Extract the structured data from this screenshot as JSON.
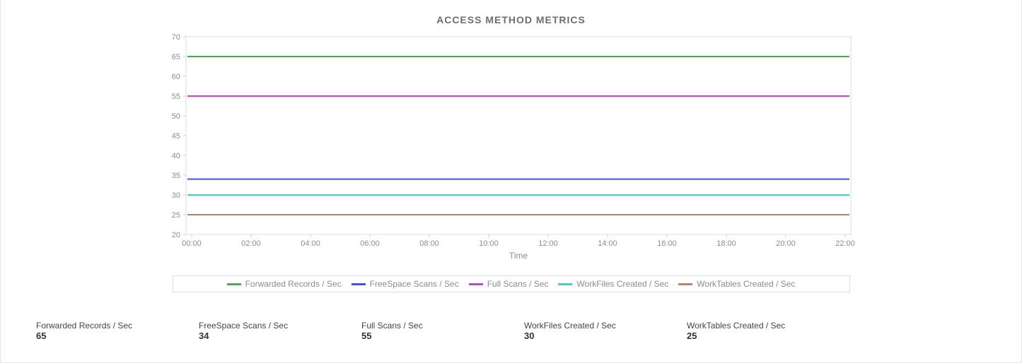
{
  "chart_data": {
    "type": "line",
    "title": "ACCESS METHOD METRICS",
    "xlabel": "Time",
    "ylabel": "",
    "ylim": [
      20,
      70
    ],
    "yticks": [
      20,
      25,
      30,
      35,
      40,
      45,
      50,
      55,
      60,
      65,
      70
    ],
    "categories": [
      "00:00",
      "02:00",
      "04:00",
      "06:00",
      "08:00",
      "10:00",
      "12:00",
      "14:00",
      "16:00",
      "18:00",
      "20:00",
      "22:00"
    ],
    "series": [
      {
        "name": "Forwarded Records / Sec",
        "color": "#3cb544",
        "values": [
          65,
          65,
          65,
          65,
          65,
          65,
          65,
          65,
          65,
          65,
          65,
          65
        ]
      },
      {
        "name": "FreeSpace Scans / Sec",
        "color": "#4b4bff",
        "values": [
          34,
          34,
          34,
          34,
          34,
          34,
          34,
          34,
          34,
          34,
          34,
          34
        ]
      },
      {
        "name": "Full Scans / Sec",
        "color": "#d63cd6",
        "values": [
          55,
          55,
          55,
          55,
          55,
          55,
          55,
          55,
          55,
          55,
          55,
          55
        ]
      },
      {
        "name": "WorkFiles Created / Sec",
        "color": "#3ccfcf",
        "values": [
          30,
          30,
          30,
          30,
          30,
          30,
          30,
          30,
          30,
          30,
          30,
          30
        ]
      },
      {
        "name": "WorkTables Created / Sec",
        "color": "#b9836e",
        "values": [
          25,
          25,
          25,
          25,
          25,
          25,
          25,
          25,
          25,
          25,
          25,
          25
        ]
      }
    ]
  },
  "stats": [
    {
      "label": "Forwarded Records / Sec",
      "value": "65"
    },
    {
      "label": "FreeSpace Scans / Sec",
      "value": "34"
    },
    {
      "label": "Full Scans / Sec",
      "value": "55"
    },
    {
      "label": "WorkFiles Created / Sec",
      "value": "30"
    },
    {
      "label": "WorkTables Created / Sec",
      "value": "25"
    }
  ]
}
